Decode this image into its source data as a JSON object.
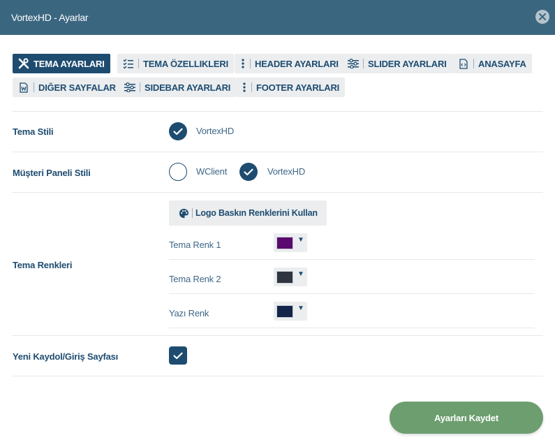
{
  "window": {
    "title": "VortexHD - Ayarlar"
  },
  "tabs": [
    {
      "label": "TEMA AYARLARI",
      "icon": "tools-icon",
      "active": true
    },
    {
      "label": "TEMA ÖZELLIKLERI",
      "icon": "checklist-icon",
      "active": false
    },
    {
      "label": "HEADER AYARLARI",
      "icon": "vertical-dots-icon",
      "active": false
    },
    {
      "label": "SLIDER AYARLARI",
      "icon": "sliders-icon",
      "active": false
    },
    {
      "label": "ANASAYFA",
      "icon": "code-file-icon",
      "active": false
    },
    {
      "label": "DIĞER SAYFALAR",
      "icon": "word-file-icon",
      "active": false
    },
    {
      "label": "SIDEBAR AYARLARI",
      "icon": "sliders-icon",
      "active": false
    },
    {
      "label": "FOOTER AYARLARI",
      "icon": "vertical-dots-icon",
      "active": false
    }
  ],
  "tema_stili": {
    "label": "Tema Stili",
    "options": [
      {
        "label": "VortexHD",
        "selected": true
      }
    ]
  },
  "musteri_paneli": {
    "label": "Müşteri Paneli Stili",
    "options": [
      {
        "label": "WClient",
        "selected": false
      },
      {
        "label": "VortexHD",
        "selected": true
      }
    ]
  },
  "tema_renkleri": {
    "label": "Tema Renkleri",
    "logo_button": "Logo Baskın Renklerini Kullan",
    "colors": [
      {
        "label": "Tema Renk 1",
        "value": "#5a0a6e"
      },
      {
        "label": "Tema Renk 2",
        "value": "#2e3440"
      },
      {
        "label": "Yazı Renk",
        "value": "#14234a"
      }
    ]
  },
  "yeni_kaydol": {
    "label": "Yeni Kaydol/Giriş Sayfası",
    "checked": true
  },
  "footer": {
    "save_label": "Ayarları Kaydet"
  },
  "theme": {
    "primary": "#1e4c70",
    "titlebar": "#3b6680",
    "save": "#6c9e6f"
  }
}
